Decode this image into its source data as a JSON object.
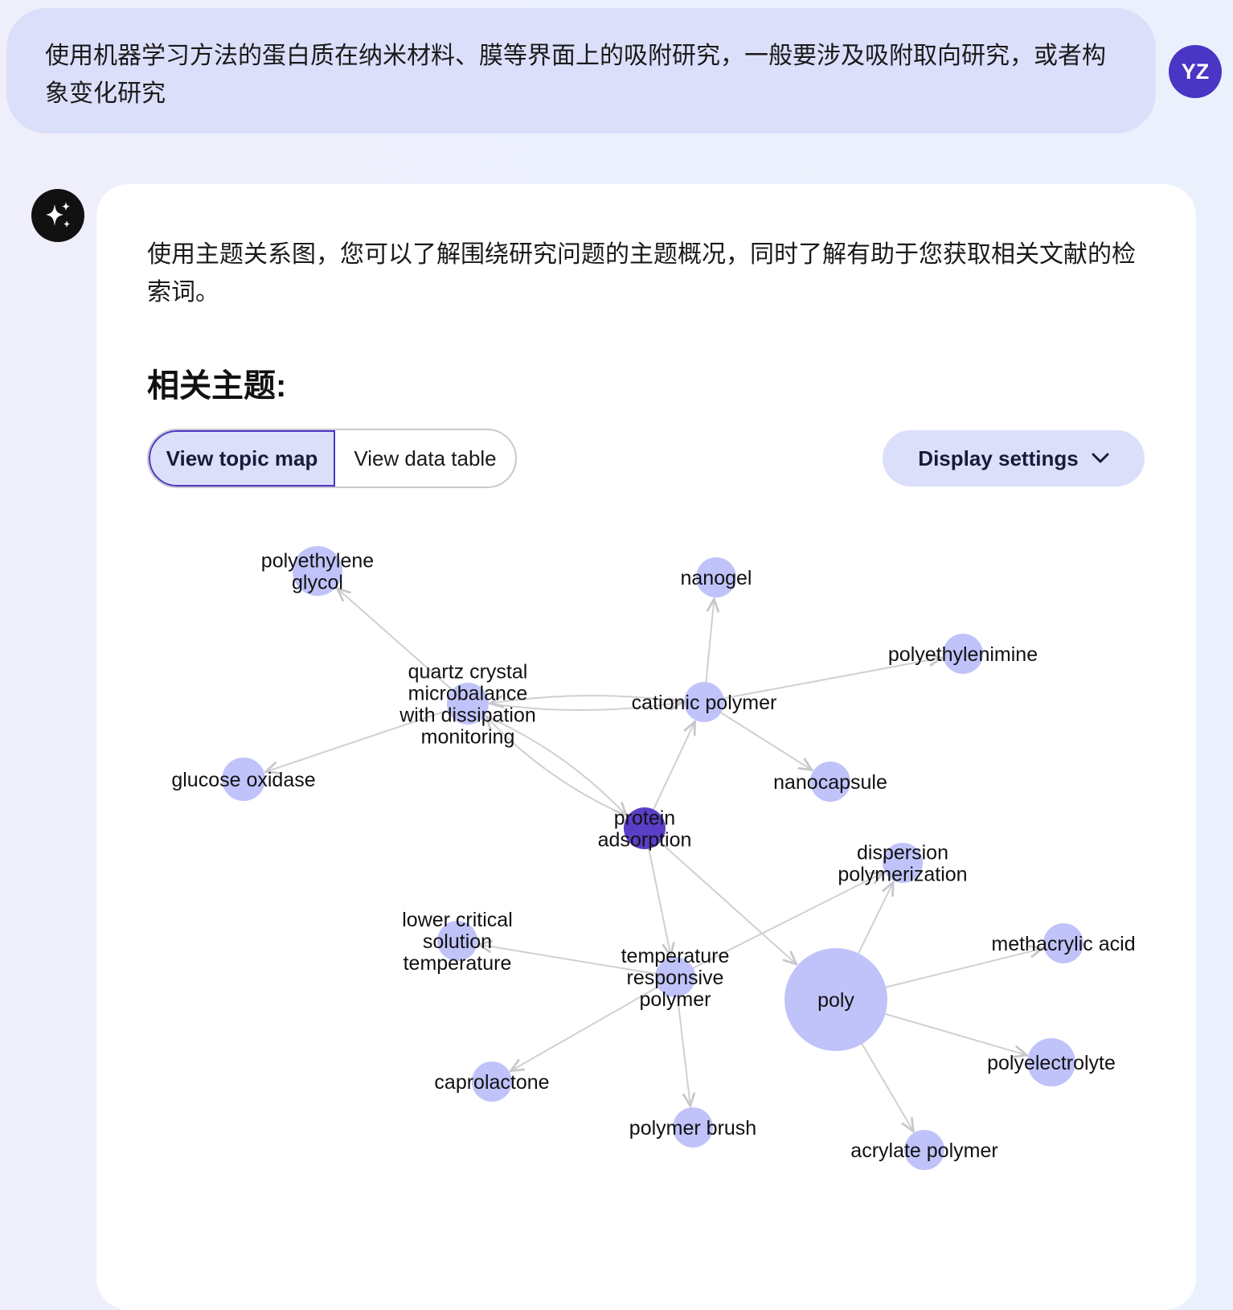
{
  "user": {
    "message": "使用机器学习方法的蛋白质在纳米材料、膜等界面上的吸附研究，一般要涉及吸附取向研究，或者构象变化研究",
    "avatar_initials": "YZ"
  },
  "assistant": {
    "icon": "sparkle-icon",
    "intro": "使用主题关系图，您可以了解围绕研究问题的主题概况，同时了解有助于您获取相关文献的检索词。",
    "section_title": "相关主题:",
    "view_tabs": {
      "topic_map": "View topic map",
      "data_table": "View data table",
      "active": "topic_map"
    },
    "display_settings_label": "Display settings"
  },
  "colors": {
    "accent": "#4a35c4",
    "node": "#c0c3f9",
    "central_node": "#5b3ec7",
    "edge": "#d0d0d4",
    "bubble": "#dcdffa"
  },
  "topic_map": {
    "nodes": [
      {
        "id": "protein_adsorption",
        "label": [
          "protein",
          "adsorption"
        ],
        "central": true
      },
      {
        "id": "qcmd",
        "label": [
          "quartz crystal",
          "microbalance",
          "with dissipation",
          "monitoring"
        ]
      },
      {
        "id": "peg",
        "label": [
          "polyethylene",
          "glycol"
        ]
      },
      {
        "id": "glucose_oxidase",
        "label": [
          "glucose oxidase"
        ]
      },
      {
        "id": "cationic_polymer",
        "label": [
          "cationic polymer"
        ]
      },
      {
        "id": "nanogel",
        "label": [
          "nanogel"
        ]
      },
      {
        "id": "polyethylenimine",
        "label": [
          "polyethylenimine"
        ]
      },
      {
        "id": "nanocapsule",
        "label": [
          "nanocapsule"
        ]
      },
      {
        "id": "dispersion_polymerization",
        "label": [
          "dispersion",
          "polymerization"
        ]
      },
      {
        "id": "poly",
        "label": [
          "poly"
        ],
        "large": true
      },
      {
        "id": "methacrylic_acid",
        "label": [
          "methacrylic acid"
        ]
      },
      {
        "id": "polyelectrolyte",
        "label": [
          "polyelectrolyte"
        ]
      },
      {
        "id": "acrylate_polymer",
        "label": [
          "acrylate polymer"
        ]
      },
      {
        "id": "trp",
        "label": [
          "temperature",
          "responsive",
          "polymer"
        ]
      },
      {
        "id": "lcst",
        "label": [
          "lower critical",
          "solution",
          "temperature"
        ]
      },
      {
        "id": "caprolactone",
        "label": [
          "caprolactone"
        ]
      },
      {
        "id": "polymer_brush",
        "label": [
          "polymer brush"
        ]
      }
    ],
    "edges": [
      {
        "from": "qcmd",
        "to": "peg"
      },
      {
        "from": "qcmd",
        "to": "glucose_oxidase"
      },
      {
        "from": "qcmd",
        "to": "cationic_polymer"
      },
      {
        "from": "cationic_polymer",
        "to": "qcmd"
      },
      {
        "from": "qcmd",
        "to": "protein_adsorption"
      },
      {
        "from": "protein_adsorption",
        "to": "qcmd"
      },
      {
        "from": "cationic_polymer",
        "to": "nanogel"
      },
      {
        "from": "cationic_polymer",
        "to": "polyethylenimine"
      },
      {
        "from": "cationic_polymer",
        "to": "nanocapsule"
      },
      {
        "from": "protein_adsorption",
        "to": "cationic_polymer"
      },
      {
        "from": "protein_adsorption",
        "to": "poly"
      },
      {
        "from": "protein_adsorption",
        "to": "trp"
      },
      {
        "from": "trp",
        "to": "dispersion_polymerization"
      },
      {
        "from": "trp",
        "to": "lcst"
      },
      {
        "from": "trp",
        "to": "caprolactone"
      },
      {
        "from": "trp",
        "to": "polymer_brush"
      },
      {
        "from": "poly",
        "to": "dispersion_polymerization"
      },
      {
        "from": "poly",
        "to": "methacrylic_acid"
      },
      {
        "from": "poly",
        "to": "polyelectrolyte"
      },
      {
        "from": "poly",
        "to": "acrylate_polymer"
      }
    ]
  }
}
